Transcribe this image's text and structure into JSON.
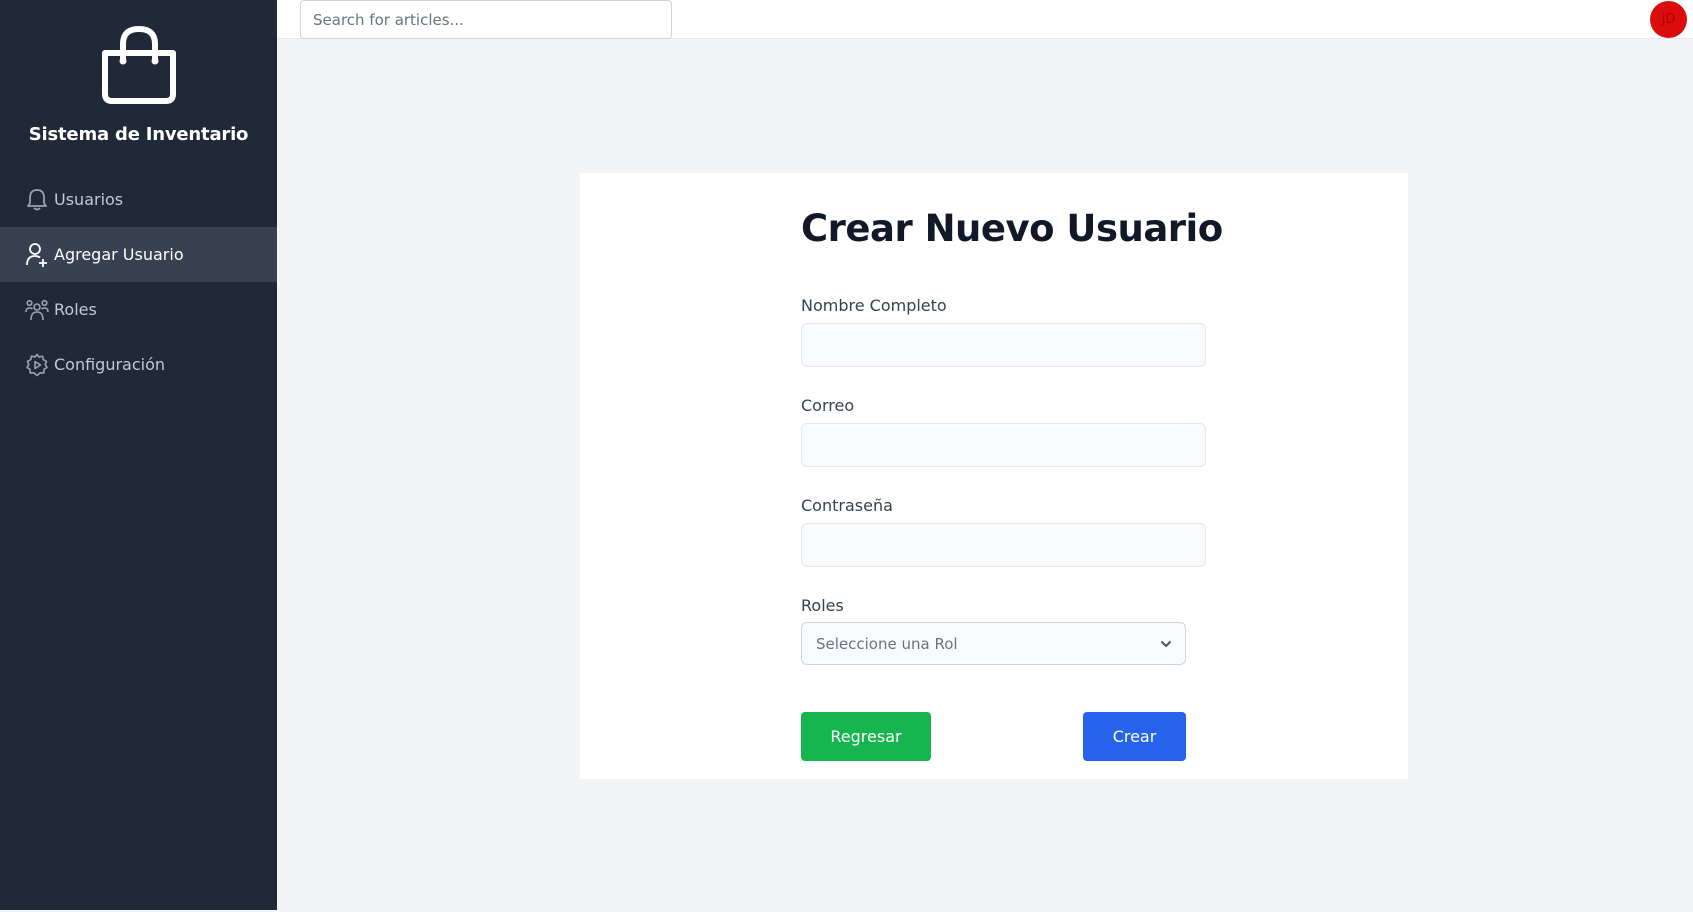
{
  "app": {
    "brand": "Sistema de Inventario",
    "brand_icon": "shopping-bag-icon"
  },
  "sidebar": {
    "items": [
      {
        "label": "Usuarios",
        "icon": "bell-icon",
        "active": false
      },
      {
        "label": "Agregar Usuario",
        "icon": "user-plus-icon",
        "active": true
      },
      {
        "label": "Roles",
        "icon": "users-group-icon",
        "active": false
      },
      {
        "label": "Configuración",
        "icon": "gear-icon",
        "active": false
      }
    ]
  },
  "topbar": {
    "search_placeholder": "Search for articles...",
    "avatar_initials": "JD",
    "avatar_color": "#dc0c0c"
  },
  "form": {
    "title": "Crear Nuevo Usuario",
    "fields": {
      "name_label": "Nombre Completo",
      "name_value": "",
      "email_label": "Correo",
      "email_value": "",
      "password_label": "Contraseña",
      "password_value": "",
      "roles_label": "Roles",
      "roles_selected": "Seleccione una Rol"
    },
    "buttons": {
      "back_label": "Regresar",
      "back_color": "#16b550",
      "create_label": "Crear",
      "create_color": "#2563eb"
    }
  },
  "colors": {
    "sidebar_bg": "#1f2937",
    "sidebar_active_bg": "#374151",
    "page_bg": "#f3f4f6"
  }
}
